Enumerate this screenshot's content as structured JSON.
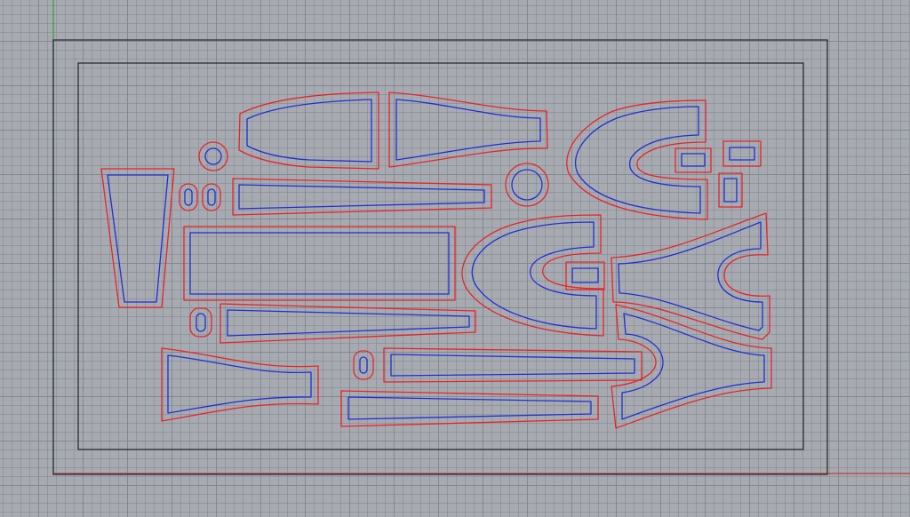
{
  "viewport": {
    "view": "top",
    "grid": true,
    "colors": {
      "background": "#a7abb1",
      "grid_minor": "#8f949a",
      "grid_major": "#7c8187",
      "frame": "#2b2d30",
      "outer_cut": "#e8232a",
      "inner_cut": "#1f2fd6",
      "x_axis": "#c43a3a",
      "y_axis": "#3a9a3a"
    }
  },
  "nested_parts": {
    "total_parts": 21,
    "shapes": [
      "bottle",
      "wedge",
      "strip",
      "rectangle",
      "u-bracket",
      "fork",
      "slot",
      "circle"
    ]
  }
}
